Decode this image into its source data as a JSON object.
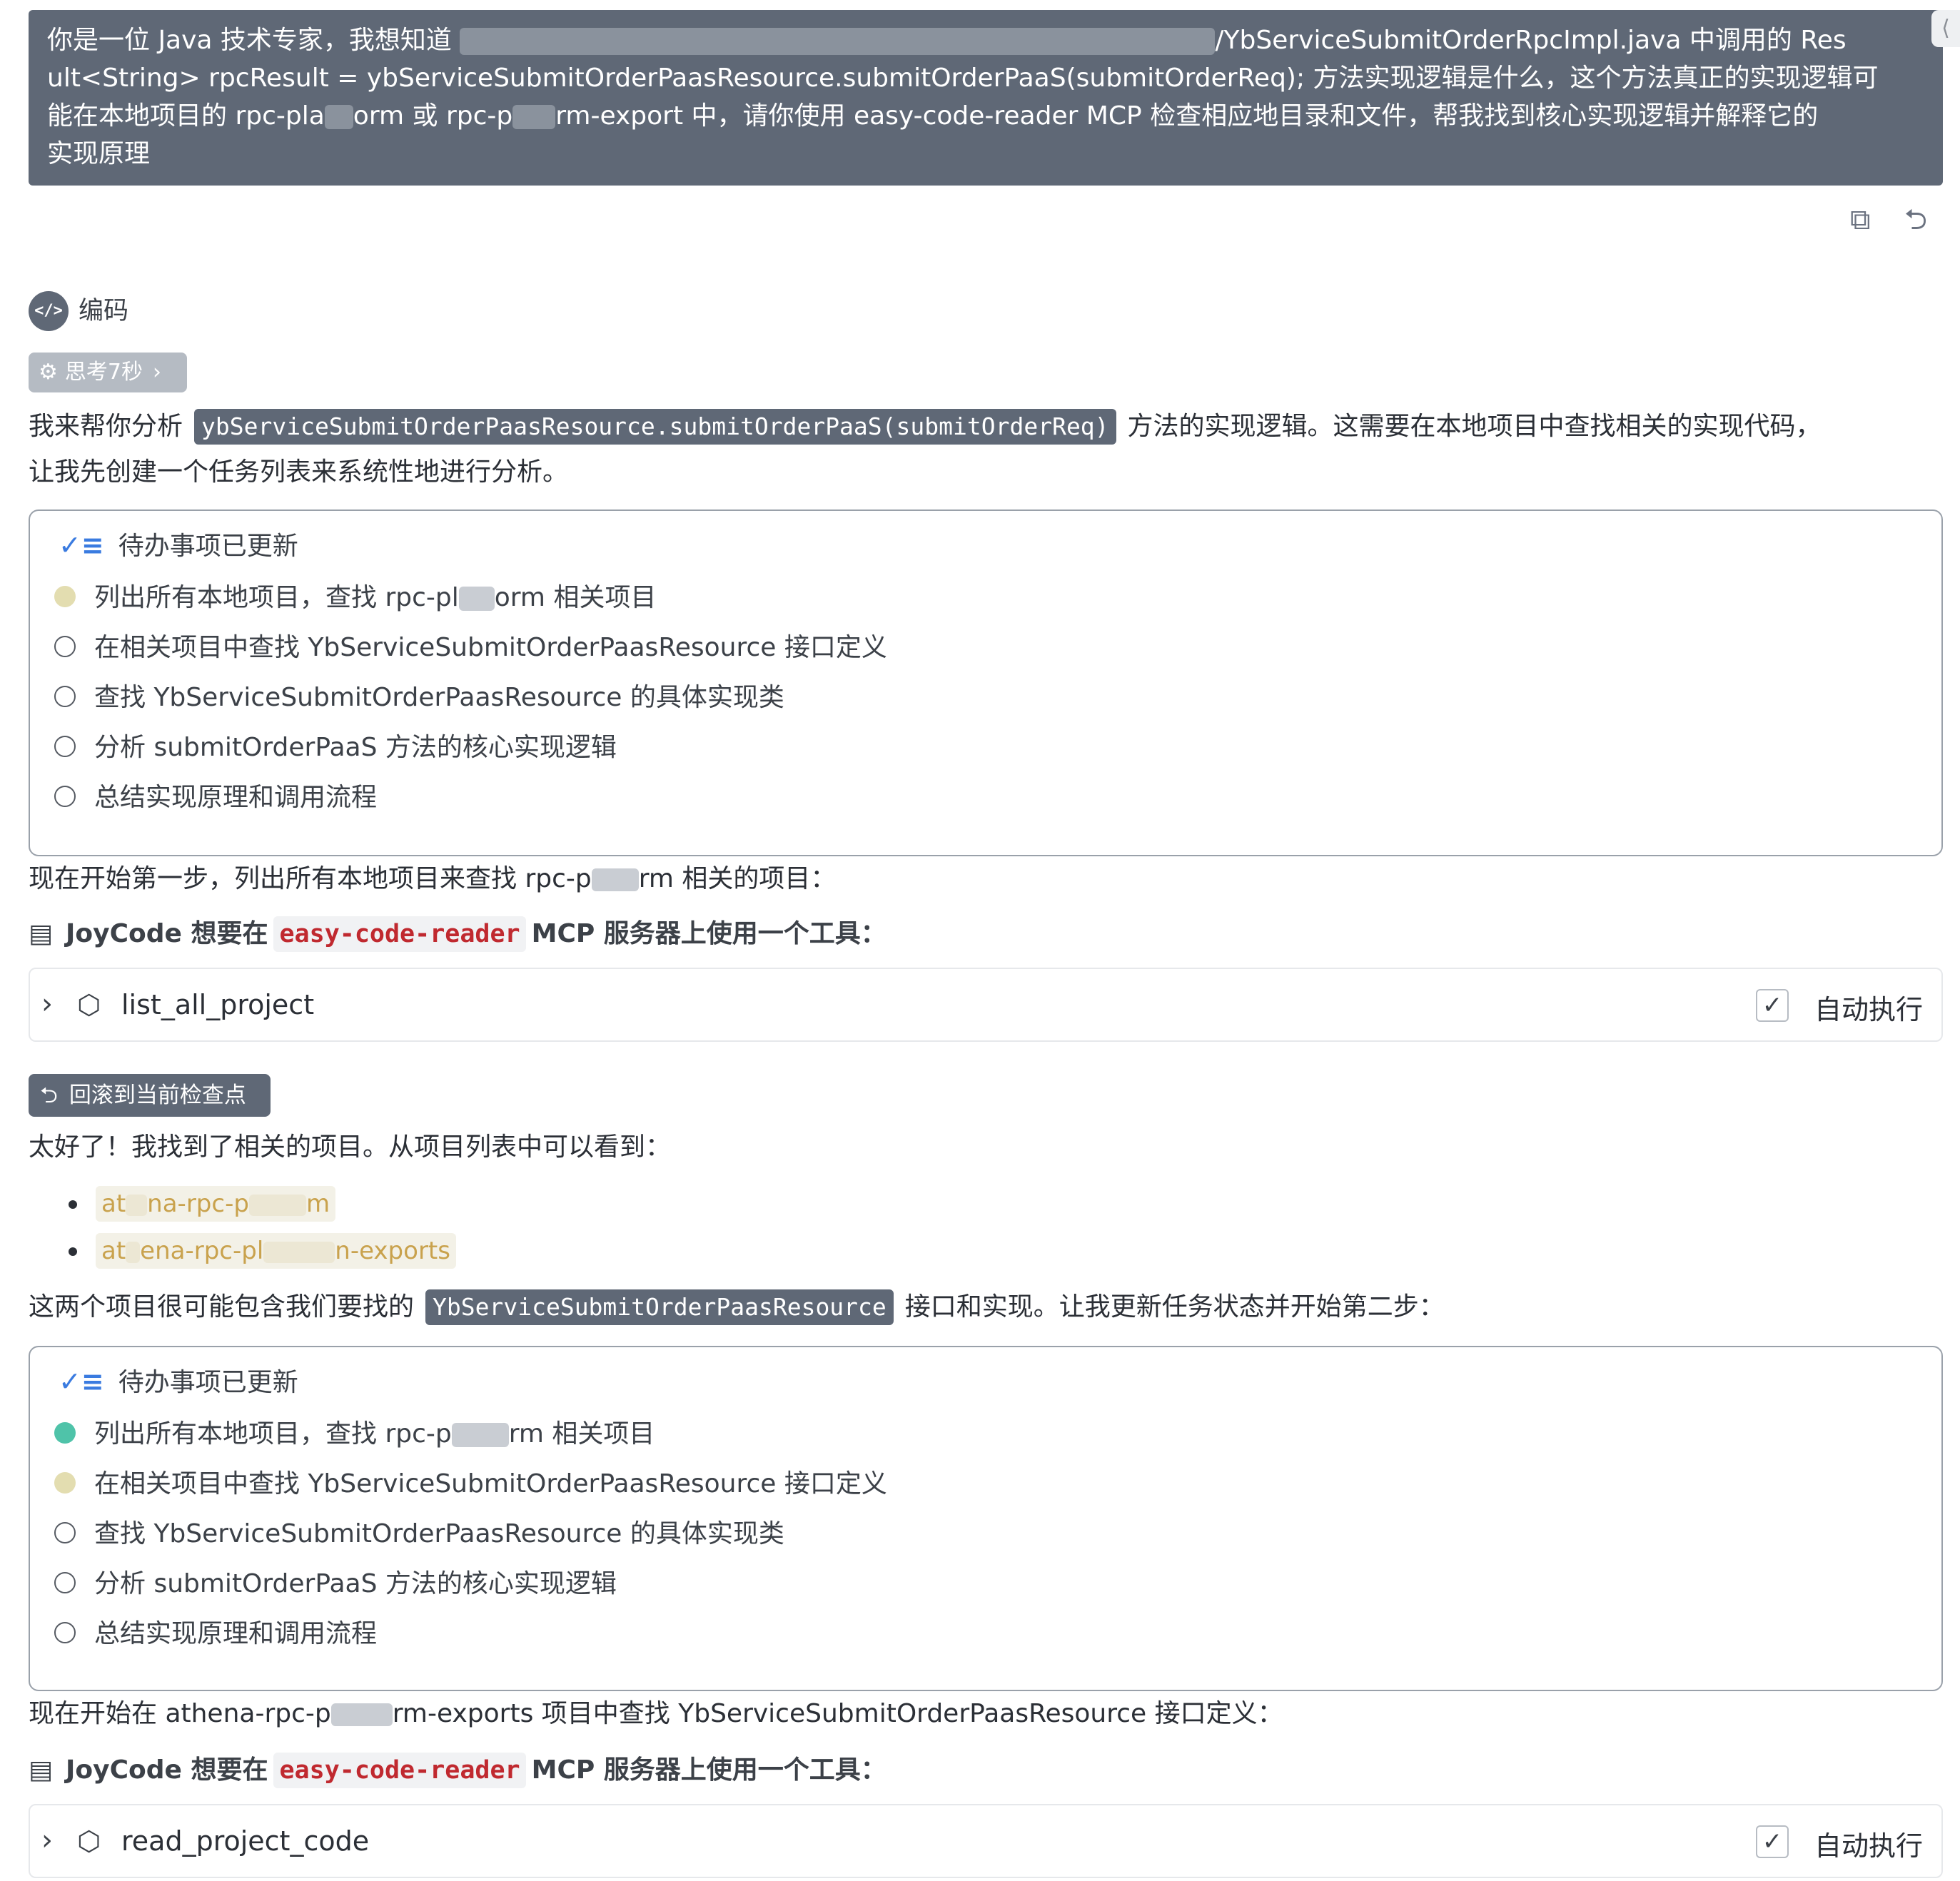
{
  "prompt": {
    "line1_prefix": "你是一位 Java 技术专家，我想知道",
    "line1_suffix": "/YbServiceSubmitOrderRpcImpl.java 中调用的 Res",
    "line2": "ult<String> rpcResult = ybServiceSubmitOrderPaasResource.submitOrderPaaS(submitOrderReq); 方法实现逻辑是什么，这个方法真正的实现逻辑可",
    "line3_a": "能在本地项目的 rpc-pla",
    "line3_b": "orm 或 rpc-p",
    "line3_c": "rm-export 中，请你使用 easy-code-reader MCP 检查相应地目录和文件，帮我找到核心实现逻辑并解释它的",
    "line4": "实现原理"
  },
  "actions": {
    "copy_icon": "⧉",
    "undo_icon": "⮌",
    "close_icon": "⟨"
  },
  "mode": {
    "icon": "</>",
    "label": "编码"
  },
  "thinking": {
    "label": "思考7秒"
  },
  "intro": {
    "prefix": "我来帮你分析",
    "code": "ybServiceSubmitOrderPaasResource.submitOrderPaaS(submitOrderReq)",
    "suffix": "方法的实现逻辑。这需要在本地项目中查找相关的实现代码，",
    "line2": "让我先创建一个任务列表来系统性地进行分析。"
  },
  "todo1": {
    "title": "待办事项已更新",
    "items": [
      {
        "a": "列出所有本地项目，查找 rpc-pl",
        "b": "orm 相关项目",
        "status": "progress"
      },
      {
        "a": "在相关项目中查找 YbServiceSubmitOrderPaasResource 接口定义",
        "status": "pending"
      },
      {
        "a": "查找 YbServiceSubmitOrderPaasResource 的具体实现类",
        "status": "pending"
      },
      {
        "a": "分析 submitOrderPaaS 方法的核心实现逻辑",
        "status": "pending"
      },
      {
        "a": "总结实现原理和调用流程",
        "status": "pending"
      }
    ]
  },
  "step1": {
    "a": "现在开始第一步，列出所有本地项目来查找 rpc-p",
    "b": "rm 相关的项目："
  },
  "mcp1": {
    "app": "JoyCode 想要在",
    "server": "easy-code-reader",
    "tail": "MCP 服务器上使用一个工具："
  },
  "tool1": {
    "name": "list_all_project",
    "auto": "自动执行"
  },
  "rollback": {
    "label": "回滚到当前检查点"
  },
  "found": {
    "text": "太好了！我找到了相关的项目。从项目列表中可以看到："
  },
  "projects": [
    {
      "a": "at",
      "b": "na-rpc-p",
      "c": "m"
    },
    {
      "a": "at",
      "b": "ena-rpc-pl",
      "c": "n-exports"
    }
  ],
  "contains": {
    "prefix": "这两个项目很可能包含我们要找的",
    "code": "YbServiceSubmitOrderPaasResource",
    "suffix": "接口和实现。让我更新任务状态并开始第二步："
  },
  "todo2": {
    "title": "待办事项已更新",
    "items": [
      {
        "a": "列出所有本地项目，查找 rpc-p",
        "b": "rm 相关项目",
        "status": "done"
      },
      {
        "a": "在相关项目中查找 YbServiceSubmitOrderPaasResource 接口定义",
        "status": "progress"
      },
      {
        "a": "查找 YbServiceSubmitOrderPaasResource 的具体实现类",
        "status": "pending"
      },
      {
        "a": "分析 submitOrderPaaS 方法的核心实现逻辑",
        "status": "pending"
      },
      {
        "a": "总结实现原理和调用流程",
        "status": "pending"
      }
    ]
  },
  "step2": {
    "a": "现在开始在 athena-rpc-p",
    "b": "rm-exports 项目中查找 YbServiceSubmitOrderPaasResource 接口定义："
  },
  "mcp2": {
    "app": "JoyCode 想要在",
    "server": "easy-code-reader",
    "tail": "MCP 服务器上使用一个工具："
  },
  "tool2": {
    "name": "read_project_code",
    "auto": "自动执行"
  },
  "colors": {
    "prompt_bg": "#5f6876",
    "done": "#4fc3a9",
    "progress": "#e3ddb0",
    "code_red": "#c0292f",
    "link": "#c9a24d"
  }
}
